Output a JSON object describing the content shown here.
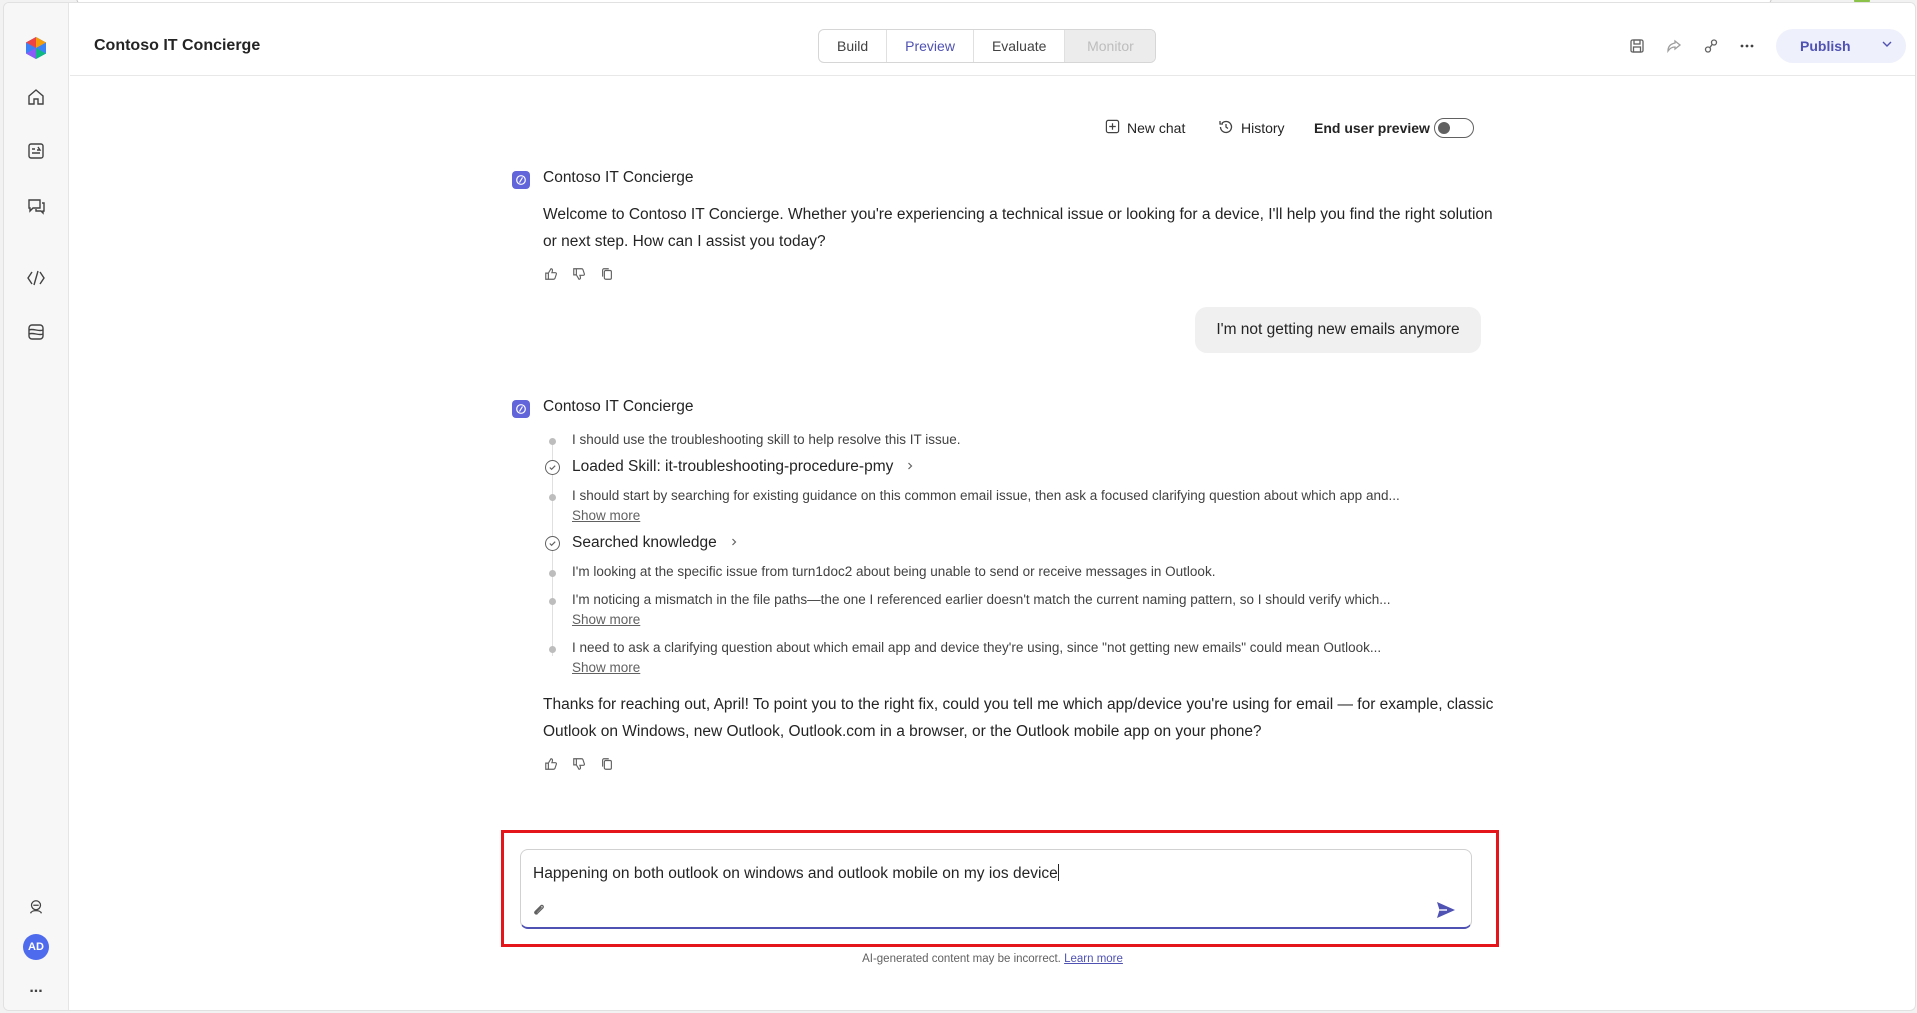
{
  "app": {
    "title": "Contoso IT Concierge",
    "accent_color": "#4f52b2",
    "user_initials": "AD"
  },
  "header": {
    "tabs": [
      {
        "label": "Build",
        "state": "normal"
      },
      {
        "label": "Preview",
        "state": "active"
      },
      {
        "label": "Evaluate",
        "state": "normal"
      },
      {
        "label": "Monitor",
        "state": "disabled"
      }
    ],
    "icons": [
      "save-icon",
      "share-icon",
      "connect-icon",
      "more-icon"
    ],
    "publish_label": "Publish"
  },
  "rail": {
    "icons": [
      "app-logo-icon",
      "home-icon",
      "agents-icon",
      "chat-icon",
      "code-icon",
      "knowledge-icon",
      "copilot-icon"
    ],
    "more_label": "..."
  },
  "controls": {
    "new_chat": "New chat",
    "history": "History",
    "end_user_preview": "End user preview",
    "end_user_preview_on": false
  },
  "conversation": {
    "bot_name": "Contoso IT Concierge",
    "welcome_message": "Welcome to Contoso IT Concierge. Whether you're experiencing a technical issue or looking for a device, I'll help you find the right solution or next step. How can I assist you today?",
    "user_message": "I'm not getting new emails anymore",
    "reasoning": [
      {
        "kind": "text",
        "text": "I should use the troubleshooting skill to help resolve this IT issue."
      },
      {
        "kind": "step",
        "text": "Loaded Skill: it-troubleshooting-procedure-pmy"
      },
      {
        "kind": "text",
        "text": "I should start by searching for existing guidance on this common email issue, then ask a focused clarifying question about which app and...",
        "show_more": "Show more"
      },
      {
        "kind": "step",
        "text": "Searched knowledge"
      },
      {
        "kind": "text",
        "text": "I'm looking at the specific issue from turn1doc2 about being unable to send or receive messages in Outlook."
      },
      {
        "kind": "text",
        "text": "I'm noticing a mismatch in the file paths—the one I referenced earlier doesn't match the current naming pattern, so I should verify which...",
        "show_more": "Show more"
      },
      {
        "kind": "text",
        "text": "I need to ask a clarifying question about which email app and device they're using, since \"not getting new emails\" could mean Outlook...",
        "show_more": "Show more"
      }
    ],
    "reply_message": "Thanks for reaching out, April! To point you to the right fix, could you tell me which app/device you're using for email — for example, classic Outlook on Windows, new Outlook, Outlook.com in a browser, or the Outlook mobile app on your phone?"
  },
  "composer": {
    "value": "Happening on both outlook on windows and outlook mobile on my ios device",
    "highlight_color": "#e4161b"
  },
  "footer": {
    "disclaimer": "AI-generated content may be incorrect.",
    "learn_more": "Learn more"
  }
}
